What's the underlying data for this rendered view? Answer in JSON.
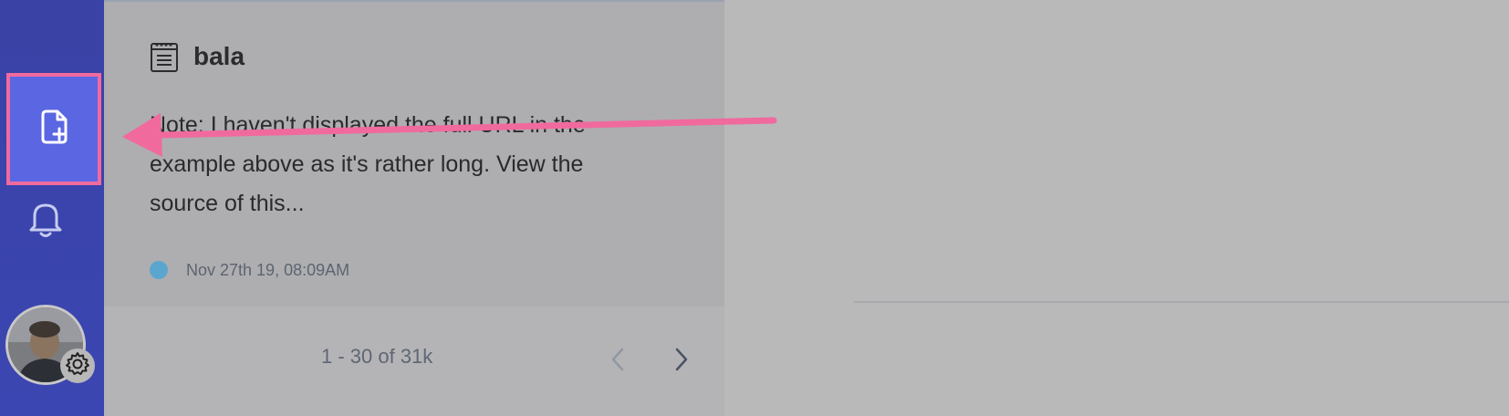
{
  "app": {
    "accent_color": "#5b66e3",
    "sidebar_color": "#3b46b2"
  },
  "sidebar": {
    "items": [
      {
        "name": "new-note",
        "icon": "file-plus-icon",
        "highlighted": true
      },
      {
        "name": "notifications",
        "icon": "bell-icon",
        "highlighted": false
      }
    ],
    "profile": {
      "avatar": "avatar",
      "settings_icon": "gear-icon"
    }
  },
  "note": {
    "title": "bala",
    "excerpt": "Note: I haven't displayed the full URL in the example above as it's rather long. View the source of this...",
    "date": "Nov 27th 19, 08:09AM",
    "status_color": "#5aa6cf",
    "icon": "notebook-icon"
  },
  "pagination": {
    "summary": "1 - 30 of 31k",
    "prev_icon": "chevron-left-icon",
    "next_icon": "chevron-right-icon"
  },
  "annotation": {
    "color": "#f06a9e",
    "shape": "arrow-pointing-left"
  }
}
